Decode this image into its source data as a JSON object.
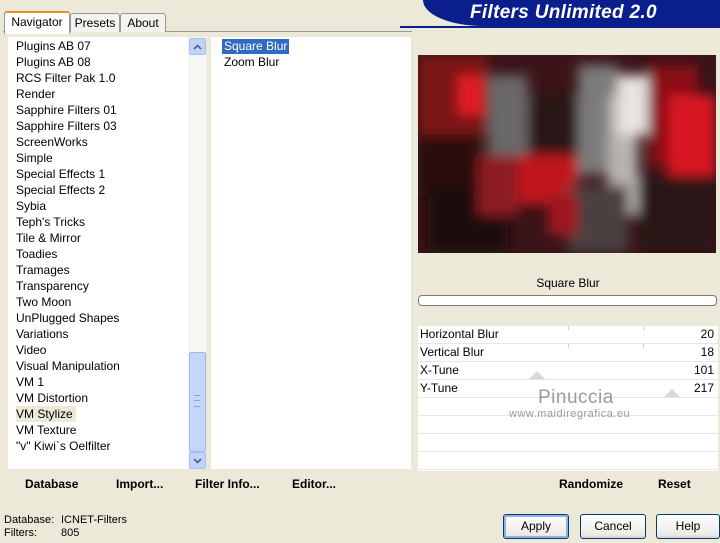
{
  "app": {
    "title": "Filters Unlimited 2.0"
  },
  "tabs": [
    {
      "label": "Navigator",
      "active": true
    },
    {
      "label": "Presets",
      "active": false
    },
    {
      "label": "About",
      "active": false
    }
  ],
  "categories": [
    "Plugins AB 07",
    "Plugins AB 08",
    "RCS Filter Pak 1.0",
    "Render",
    "Sapphire Filters 01",
    "Sapphire Filters 03",
    "ScreenWorks",
    "Simple",
    "Special Effects 1",
    "Special Effects 2",
    "Sybia",
    "Teph's Tricks",
    "Tile & Mirror",
    "Toadies",
    "Tramages",
    "Transparency",
    "Two Moon",
    "UnPlugged Shapes",
    "Variations",
    "Video",
    "Visual Manipulation",
    "VM 1",
    "VM Distortion",
    "VM Stylize",
    "VM Texture",
    "\"v\" Kiwi`s Oelfilter"
  ],
  "selected_category": "VM Stylize",
  "filters": [
    "Square Blur",
    "Zoom Blur"
  ],
  "selected_filter": "Square Blur",
  "current_filter_name": "Square Blur",
  "parameters": [
    {
      "label": "Horizontal Blur",
      "value": "20"
    },
    {
      "label": "Vertical Blur",
      "value": "18"
    },
    {
      "label": "X-Tune",
      "value": "101"
    },
    {
      "label": "Y-Tune",
      "value": "217"
    }
  ],
  "watermark": {
    "name": "Pinuccia",
    "site": "www.maidiregrafica.eu"
  },
  "left_buttons": {
    "database": "Database",
    "import": "Import...",
    "filter_info": "Filter Info...",
    "editor": "Editor..."
  },
  "right_buttons": {
    "randomize": "Randomize",
    "reset": "Reset"
  },
  "status": {
    "database_label": "Database:",
    "database_value": "ICNET-Filters",
    "filters_label": "Filters:",
    "filters_value": "805"
  },
  "dialog_buttons": {
    "apply": "Apply",
    "cancel": "Cancel",
    "help": "Help"
  },
  "colors": {
    "banner": "#0a1f8c",
    "selection": "#316ac5",
    "tab_accent": "#e68b2c"
  },
  "icons": {
    "scroll_up": "chevron-up-icon",
    "scroll_down": "chevron-down-icon"
  }
}
